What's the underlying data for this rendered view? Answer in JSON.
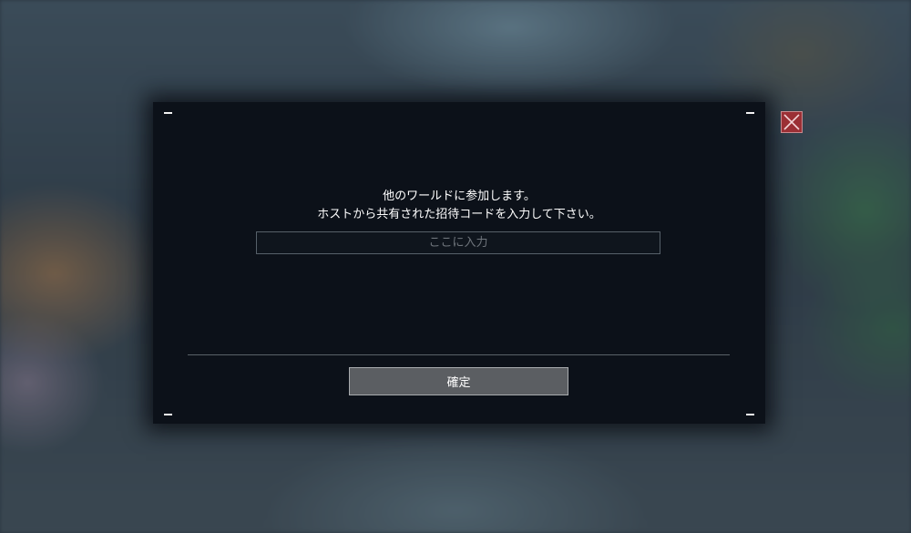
{
  "dialog": {
    "message_line1": "他のワールドに参加します。",
    "message_line2": "ホストから共有された招待コードを入力して下さい。",
    "input": {
      "value": "",
      "placeholder": "ここに入力"
    },
    "confirm_label": "確定"
  },
  "icons": {
    "close": "close-icon"
  },
  "colors": {
    "dialog_background": "#0c1119",
    "close_button": "#9b2f35",
    "confirm_button": "#5b5e62"
  }
}
